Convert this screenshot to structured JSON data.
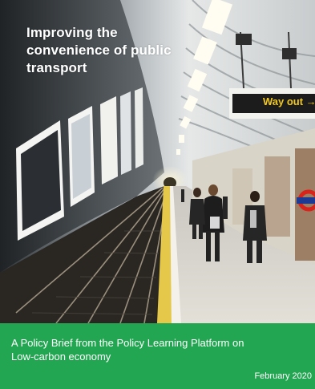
{
  "cover": {
    "title_lines": [
      "Improving the",
      "convenience of public",
      "transport"
    ],
    "subtitle_lines": [
      "A Policy Brief from the Policy Learning Platform on",
      "Low-carbon economy"
    ],
    "date": "February 2020",
    "colors": {
      "band_green": "#22a651",
      "sign_yellow": "#f2c81e",
      "roundel_red": "#d9241c",
      "roundel_blue": "#1f3a93"
    }
  },
  "scene": {
    "sign_text": "Way out →"
  }
}
